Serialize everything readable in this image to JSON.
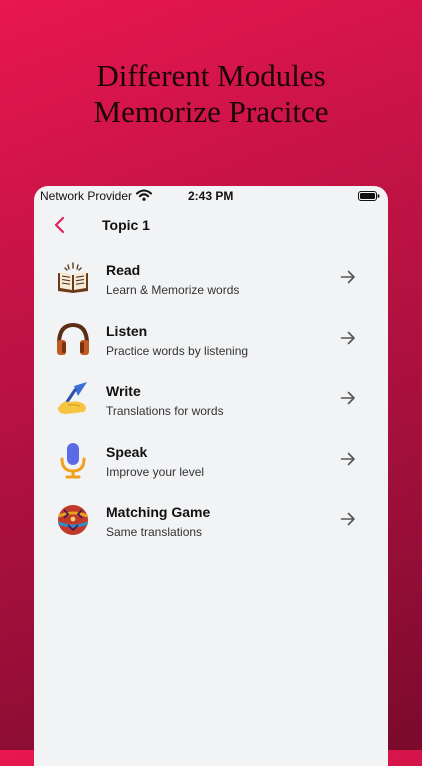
{
  "headline": {
    "line1": "Different Modules",
    "line2": "Memorize Pracitce"
  },
  "status_bar": {
    "carrier": "Network Provider",
    "time": "2:43 PM",
    "icons": [
      "wifi-icon",
      "battery-icon"
    ]
  },
  "nav": {
    "back_icon": "chevron-left-icon",
    "title": "Topic 1",
    "accent_color": "#e0245e"
  },
  "modules": [
    {
      "title": "Read",
      "subtitle": "Learn & Memorize words",
      "icon": "book-icon"
    },
    {
      "title": "Listen",
      "subtitle": "Practice words by listening",
      "icon": "headphones-icon"
    },
    {
      "title": "Write",
      "subtitle": "Translations for words",
      "icon": "writing-hand-icon"
    },
    {
      "title": "Speak",
      "subtitle": "Improve your level",
      "icon": "microphone-icon"
    },
    {
      "title": "Matching Game",
      "subtitle": "Same translations",
      "icon": "game-ball-icon"
    }
  ],
  "colors": {
    "background_top": "#e8174f",
    "background_bottom": "#7a0a2c",
    "screen": "#f2f3f5"
  }
}
